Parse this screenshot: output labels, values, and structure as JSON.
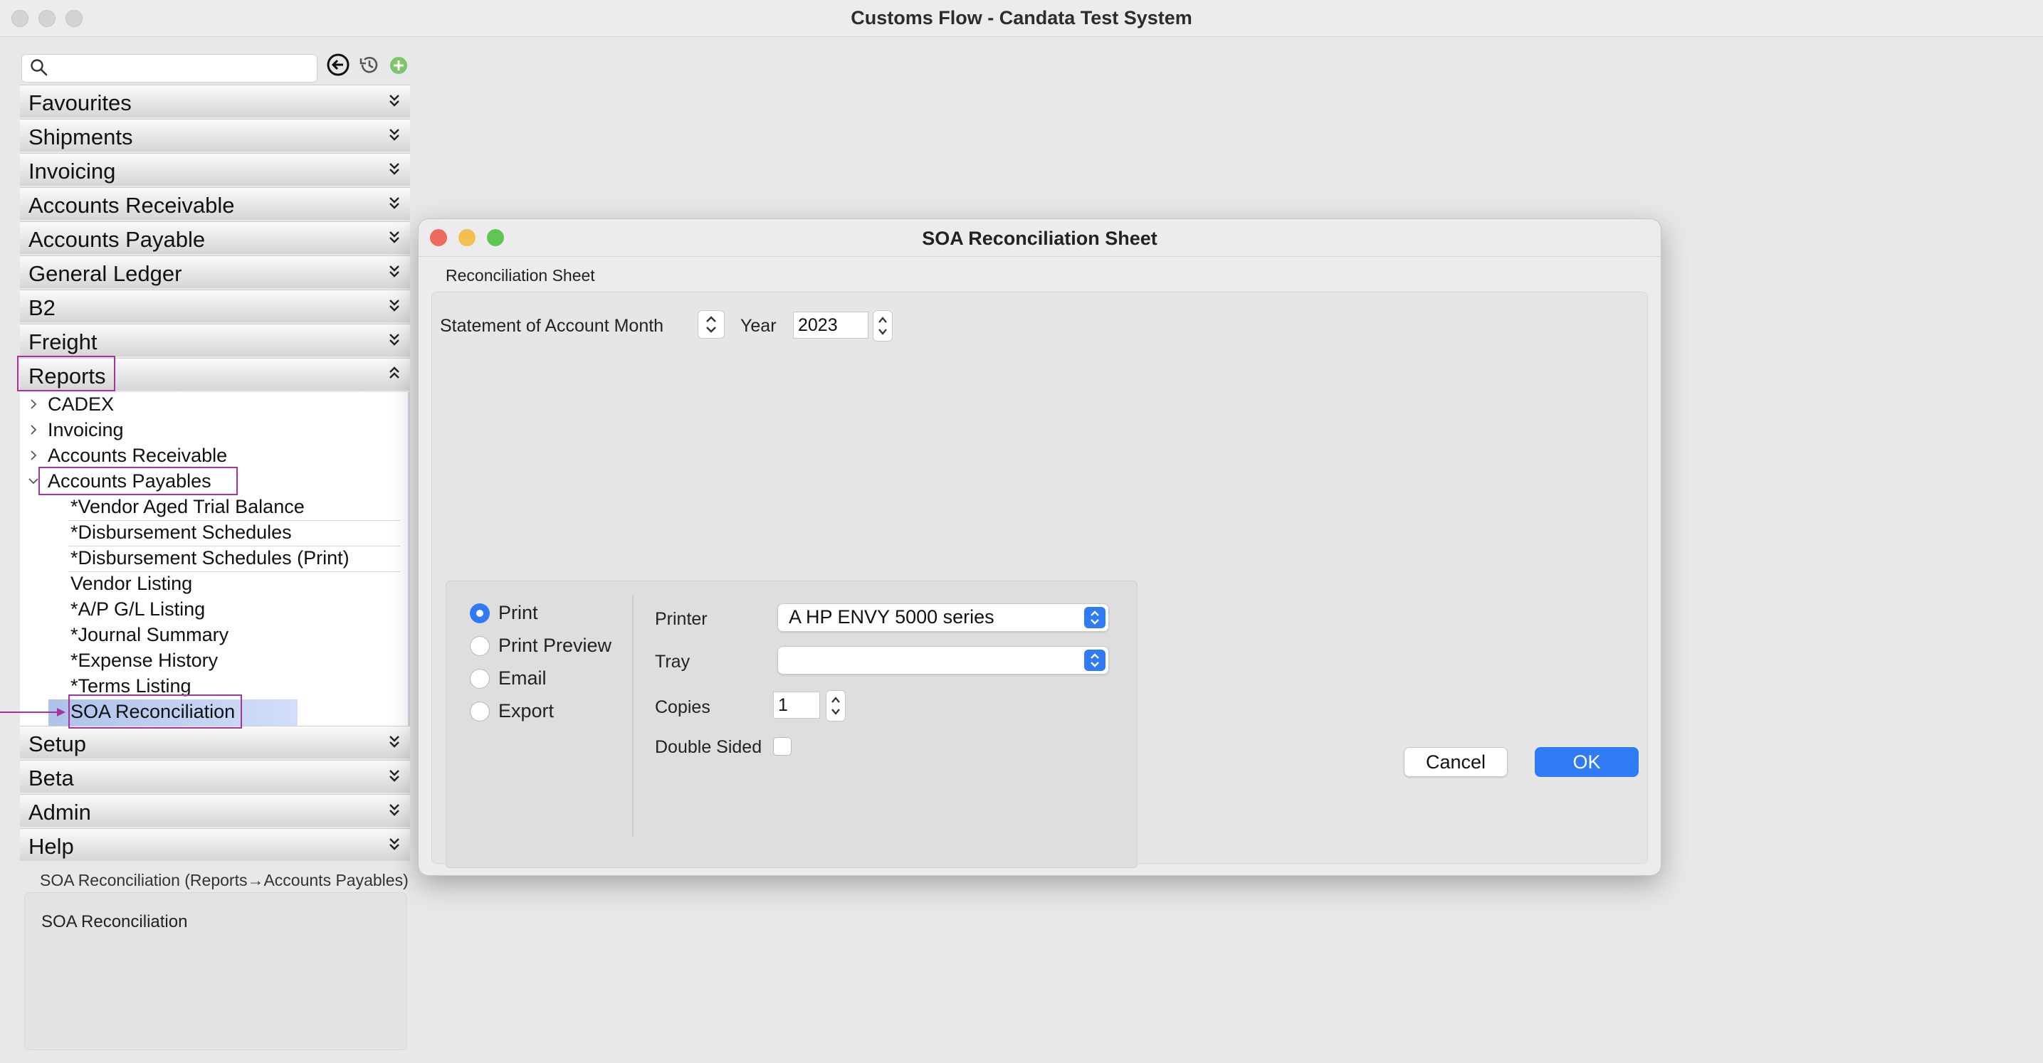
{
  "window": {
    "title": "Customs Flow - Candata Test System"
  },
  "sidebar": {
    "search_placeholder": "",
    "sections_top": [
      {
        "label": "Favourites"
      },
      {
        "label": "Shipments"
      },
      {
        "label": "Invoicing"
      },
      {
        "label": "Accounts Receivable"
      },
      {
        "label": "Accounts Payable"
      },
      {
        "label": "General Ledger"
      },
      {
        "label": "B2"
      },
      {
        "label": "Freight"
      },
      {
        "label": "Reports"
      }
    ],
    "reports_tree": {
      "groups": [
        {
          "label": "CADEX",
          "expanded": false
        },
        {
          "label": "Invoicing",
          "expanded": false
        },
        {
          "label": "Accounts Receivable",
          "expanded": false
        },
        {
          "label": "Accounts Payables",
          "expanded": true
        }
      ],
      "items": [
        {
          "label": "*Vendor Aged Trial Balance"
        },
        {
          "label": "*Disbursement Schedules"
        },
        {
          "label": "*Disbursement Schedules (Print)"
        },
        {
          "label": "Vendor Listing"
        },
        {
          "label": "*A/P G/L Listing"
        },
        {
          "label": "*Journal Summary"
        },
        {
          "label": "*Expense History"
        },
        {
          "label": "*Terms Listing"
        },
        {
          "label": "SOA Reconciliation",
          "selected": true
        }
      ]
    },
    "sections_bottom": [
      {
        "label": "Setup"
      },
      {
        "label": "Beta"
      },
      {
        "label": "Admin"
      },
      {
        "label": "Help"
      }
    ],
    "info_path": "SOA Reconciliation (Reports→Accounts Payables)",
    "info_text": "SOA Reconciliation"
  },
  "dialog": {
    "title": "SOA Reconciliation Sheet",
    "tab": "Reconciliation Sheet",
    "month_label": "Statement of Account Month",
    "month_value": "",
    "year_label": "Year",
    "year_value": "2023",
    "output_options": [
      {
        "label": "Print",
        "selected": true
      },
      {
        "label": "Print Preview",
        "selected": false
      },
      {
        "label": "Email",
        "selected": false
      },
      {
        "label": "Export",
        "selected": false
      }
    ],
    "printer_label": "Printer",
    "printer_value": "A HP ENVY 5000 series",
    "tray_label": "Tray",
    "tray_value": "",
    "copies_label": "Copies",
    "copies_value": "1",
    "double_sided_label": "Double Sided",
    "double_sided_checked": false,
    "cancel_label": "Cancel",
    "ok_label": "OK"
  },
  "colors": {
    "accent": "#2f7bf5",
    "highlight_box": "#a8329f",
    "selection": "#b9cbf0",
    "close": "#ed6a5e",
    "minimize": "#f5bf4f",
    "zoom": "#61c554"
  }
}
